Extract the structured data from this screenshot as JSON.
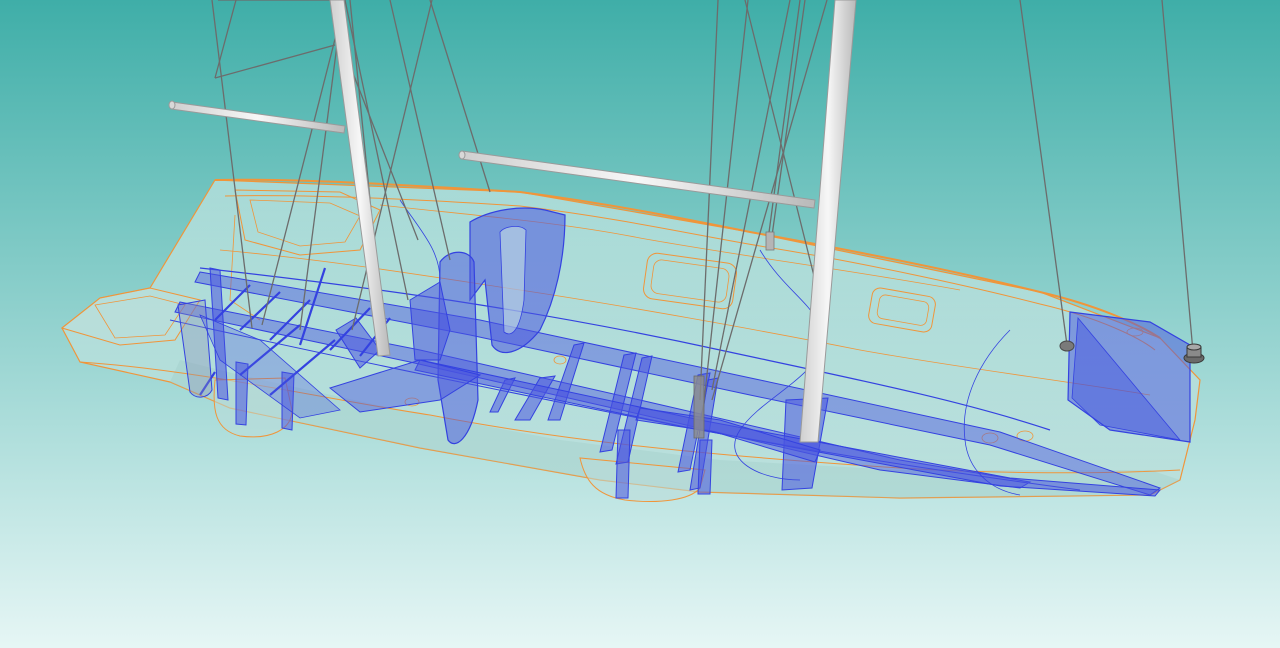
{
  "scene": {
    "subject": "sailboat-hull-3d-model",
    "view": "isometric-transparent",
    "background": {
      "top_color": "#3faea8",
      "bottom_color": "#e6f6f5"
    },
    "colors": {
      "hull_outline": "#f0953a",
      "structure": "#3442e0",
      "structure_fill": "#4a55e0",
      "hull_fill": "#cfe9e6",
      "mast": "#e4e4e4",
      "mast_edge": "#9a9a9a",
      "rigging": "#6c6c6c",
      "fitting": "#6a6a6a"
    },
    "mast_count": 2,
    "boom_count": 2,
    "visible_text": []
  }
}
